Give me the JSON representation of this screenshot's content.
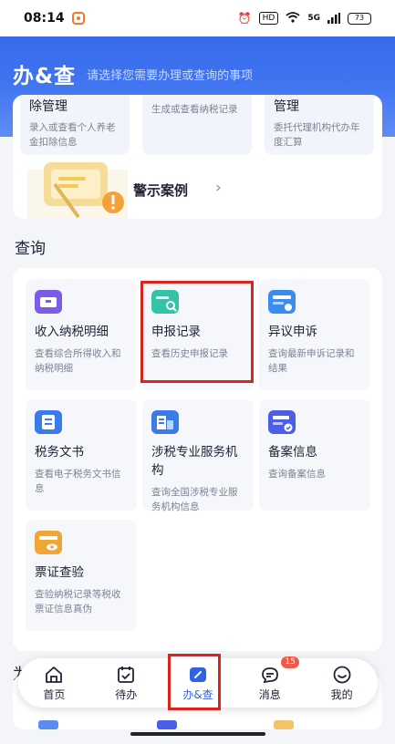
{
  "status_bar": {
    "time": "08:14",
    "network": "HD",
    "signal": "5G",
    "battery": "73"
  },
  "header": {
    "title": "办&查",
    "subtitle": "请选择您需要办理或查询的事项"
  },
  "upper_card": {
    "items": [
      {
        "title": "除管理",
        "desc": "录入或查看个人养老金扣除信息"
      },
      {
        "title": "",
        "desc": "生成或查看纳税记录"
      },
      {
        "title": "管理",
        "desc": "委托代理机构代办年度汇算"
      }
    ],
    "warning_link": "警示案例"
  },
  "section_title": "查询",
  "tiles": [
    {
      "name": "收入纳税明细",
      "desc": "查看综合所得收入和纳税明细",
      "color": "#7b5ce8"
    },
    {
      "name": "申报记录",
      "desc": "查看历史申报记录",
      "color": "#34c3a7"
    },
    {
      "name": "异议申诉",
      "desc": "查询最新申诉记录和结果",
      "color": "#3b8cf0"
    },
    {
      "name": "税务文书",
      "desc": "查看电子税务文书信息",
      "color": "#3a7be8"
    },
    {
      "name": "涉税专业服务机构",
      "desc": "查询全国涉税专业服务机构信息",
      "color": "#3a7be8"
    },
    {
      "name": "备案信息",
      "desc": "查询备案信息",
      "color": "#4a5ee8"
    },
    {
      "name": "票证查验",
      "desc": "查验纳税记录等税收票证信息真伪",
      "color": "#f0a636"
    }
  ],
  "partial_section": "为",
  "nav": [
    {
      "label": "首页",
      "icon": "home-icon"
    },
    {
      "label": "待办",
      "icon": "calendar-check-icon"
    },
    {
      "label": "办&查",
      "icon": "edit-doc-icon",
      "active": true
    },
    {
      "label": "消息",
      "icon": "message-icon",
      "badge": "15"
    },
    {
      "label": "我的",
      "icon": "smile-icon"
    }
  ]
}
